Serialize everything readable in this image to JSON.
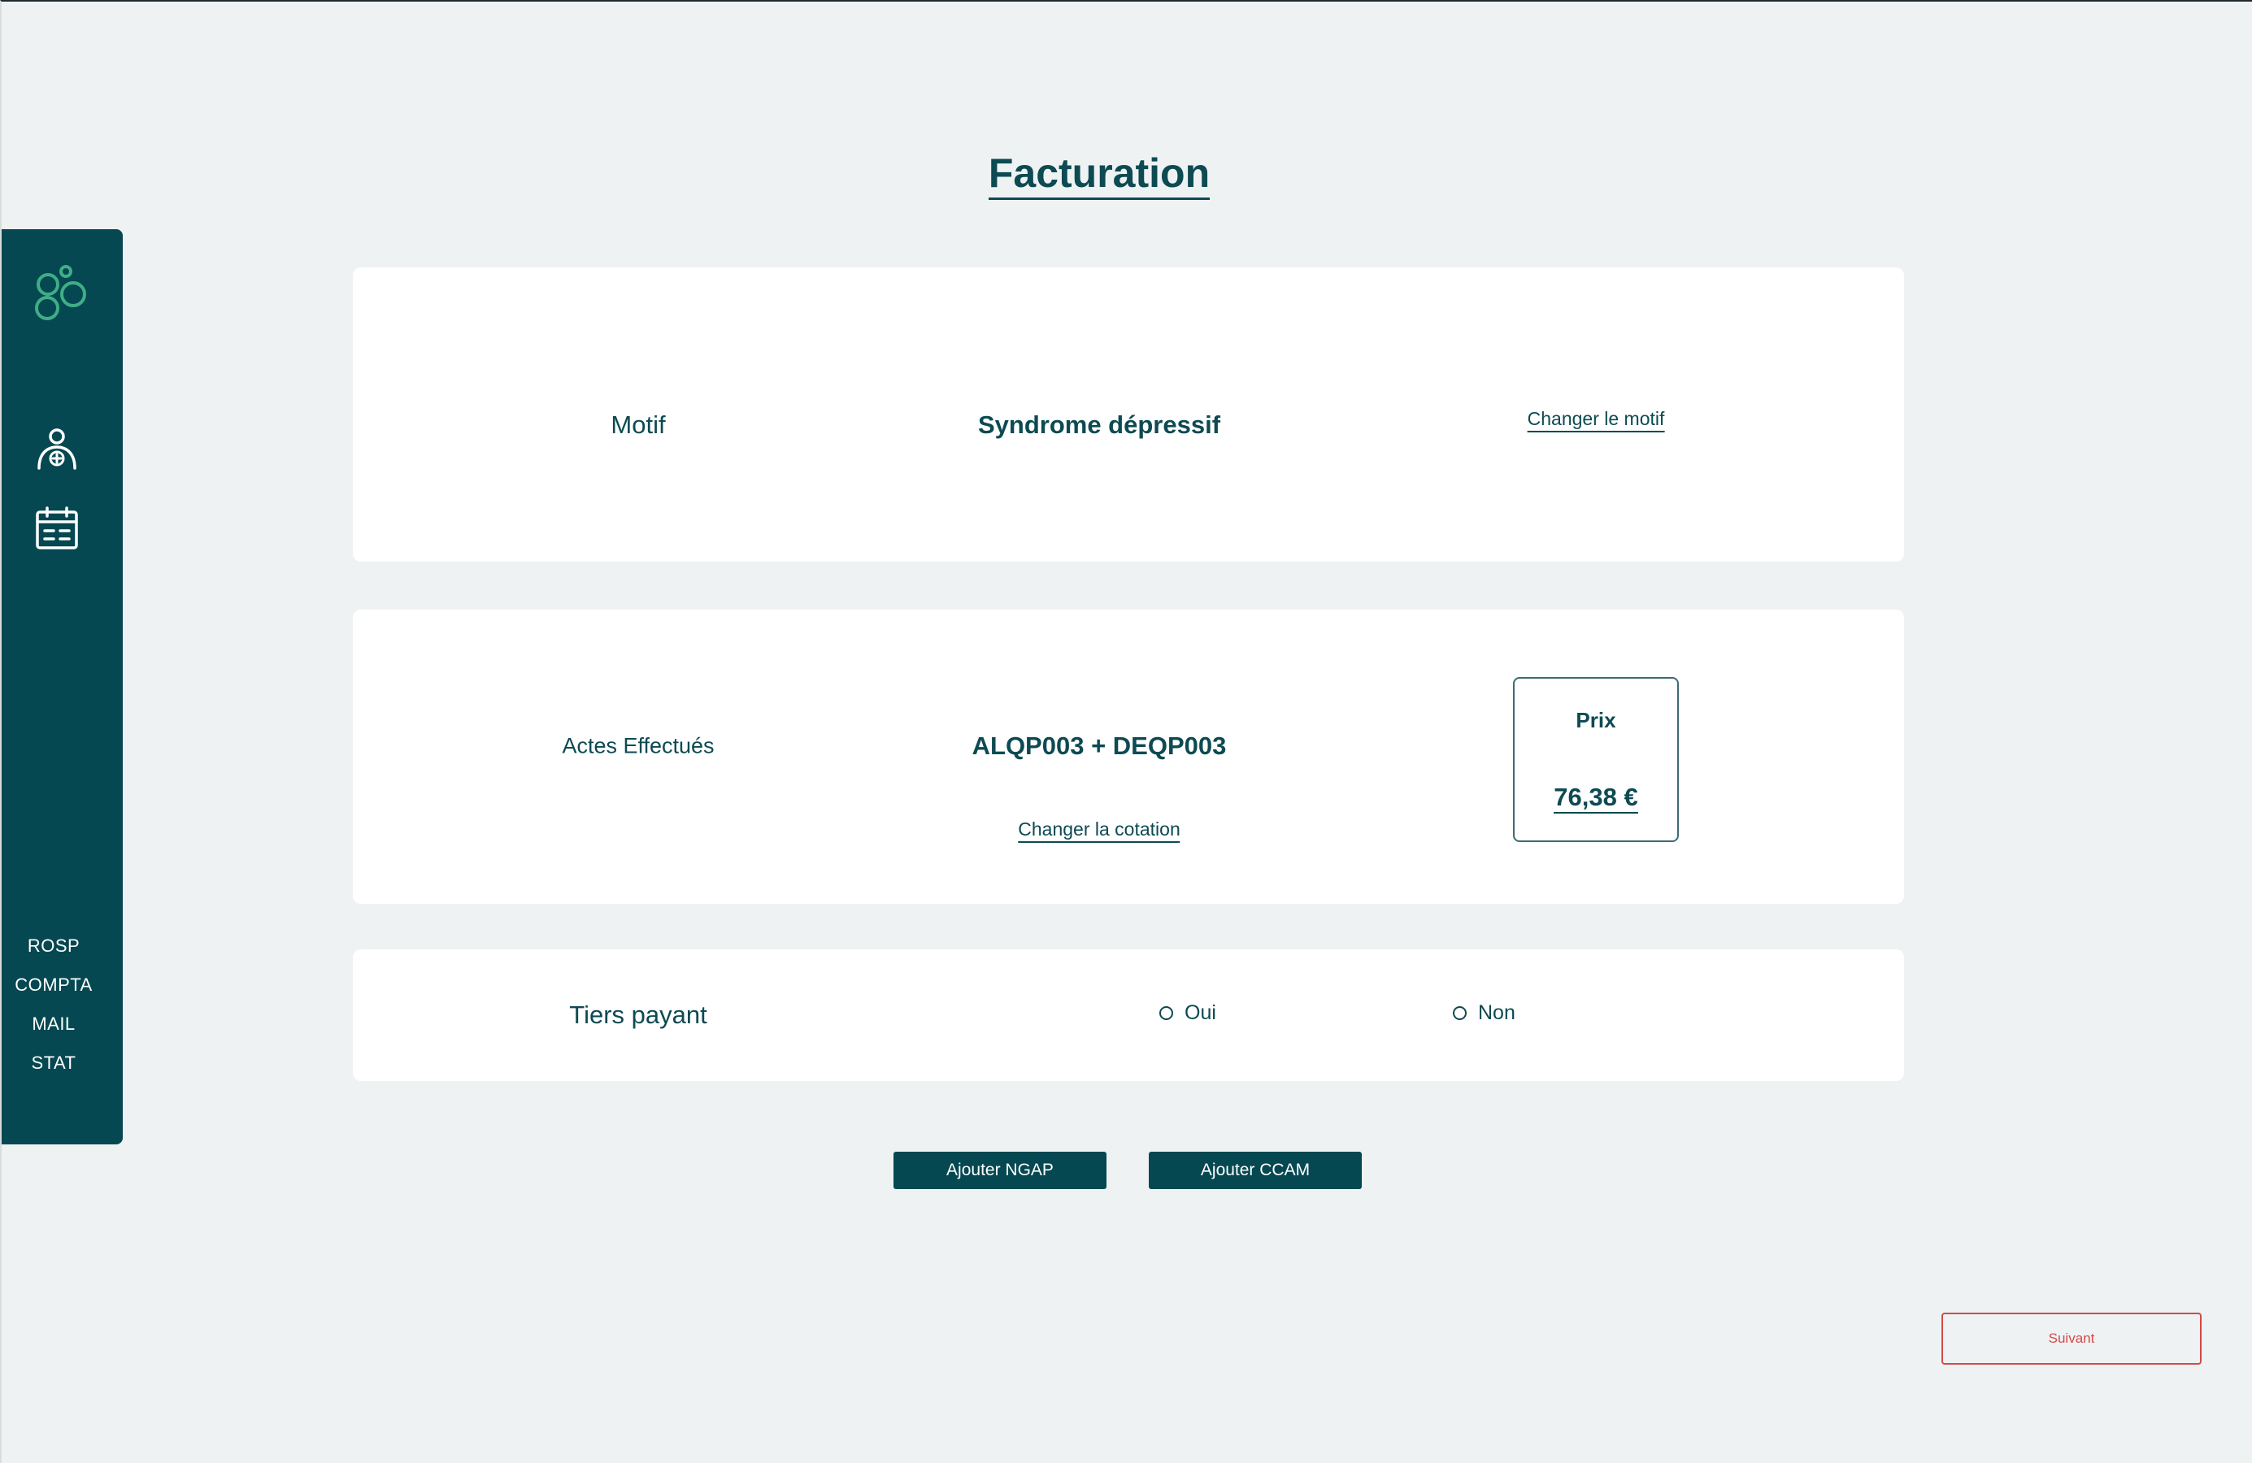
{
  "page": {
    "title": "Facturation"
  },
  "sidebar": {
    "logo_icon": "linked-circles-logo-icon",
    "nav": [
      {
        "icon": "patient-add-icon"
      },
      {
        "icon": "calendar-icon"
      }
    ],
    "links": [
      "ROSP",
      "COMPTA",
      "MAIL",
      "STAT"
    ]
  },
  "motif": {
    "label": "Motif",
    "value": "Syndrome dépressif",
    "change_link": "Changer  le motif"
  },
  "actes": {
    "label": "Actes Effectués",
    "value": "ALQP003 + DEQP003",
    "change_link": "Changer  la cotation",
    "price_label": "Prix",
    "price_value": "76,38 €"
  },
  "tiers_payant": {
    "label": "Tiers payant",
    "options": [
      "Oui",
      "Non"
    ],
    "selected": null
  },
  "actions": {
    "add_ngap": "Ajouter NGAP",
    "add_ccam": "Ajouter CCAM",
    "next": "Suivant"
  },
  "colors": {
    "primary": "#054851",
    "text": "#0d4a52",
    "background": "#eff2f3",
    "card": "#ffffff",
    "danger": "#d24a4a",
    "logo_accent": "#3fae86"
  }
}
